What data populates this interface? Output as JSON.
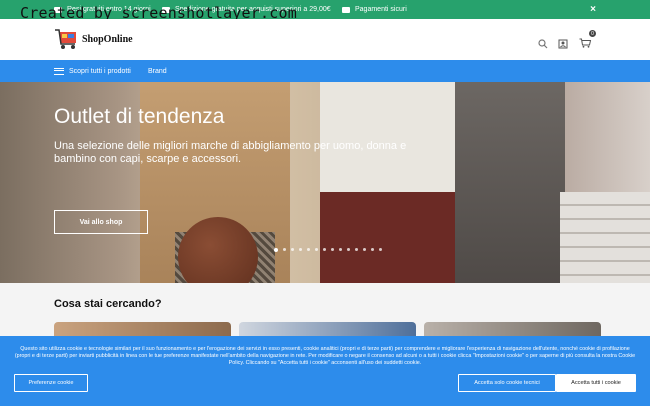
{
  "topbar": {
    "items": [
      {
        "icon": "return-box-icon",
        "text": "Resi gratuiti entro 14 giorni"
      },
      {
        "icon": "truck-icon",
        "text": "Spedizione gratuita per acquisti superiori a 29,00€"
      },
      {
        "icon": "card-icon",
        "text": "Pagamenti sicuri"
      }
    ],
    "close_label": "×",
    "background": "#27a26d"
  },
  "watermark": "Created by screenshotlayer.com",
  "header": {
    "brand": "ShopOnline",
    "cart_count": "0"
  },
  "nav": {
    "menu_label": "Scopri tutti i prodotti",
    "brand_label": "Brand",
    "background": "#2d8ceb"
  },
  "hero": {
    "title": "Outlet di tendenza",
    "subtitle": "Una selezione delle migliori marche di abbigliamento per uomo, donna e bambino con capi, scarpe e accessori.",
    "button_label": "Vai allo shop",
    "slide_count": 14,
    "active_slide": 1
  },
  "section": {
    "title": "Cosa stai cercando?"
  },
  "cookie": {
    "text": "Questo sito utilizza cookie e tecnologie similari per il suo funzionamento e per l'erogazione dei servizi in esso presenti, cookie analitici (propri e di terze parti) per comprendere e migliorare l'esperienza di navigazione dell'utente, nonché cookie di profilazione (propri e di terze parti) per inviarti pubblicità in linea con le tue preferenze manifestate nell'ambito della navigazione in rete. Per modificare o negare il consenso ad alcuni o a tutti i cookie clicca \"Impostazioni cookie\" o per saperne di più consulta la nostra Cookie Policy. Cliccando su \"Accetta tutti i cookie\" acconsenti all'uso dei suddetti cookie.",
    "pref_label": "Preferenze cookie",
    "tech_label": "Accetta solo cookie tecnici",
    "all_label": "Accetta tutti i cookie"
  }
}
